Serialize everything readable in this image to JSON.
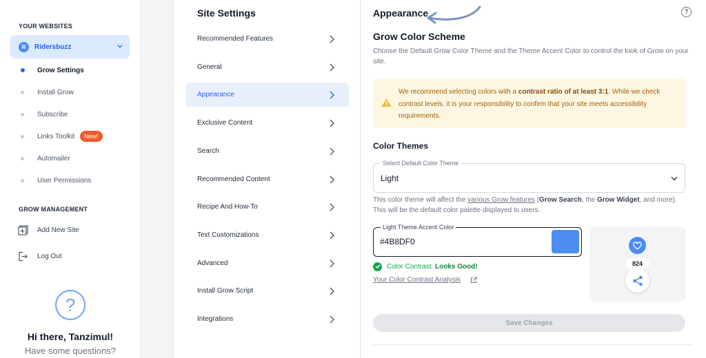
{
  "colors": {
    "accent": "#4B8DF0",
    "brand": "#2563eb",
    "badge": "#ef5a2a",
    "success": "#16a34a",
    "warning_bg": "#fdf6e3"
  },
  "sidebar": {
    "websites_title": "YOUR WEBSITES",
    "site": {
      "avatar_letter": "R",
      "name": "Ridersbuzz"
    },
    "nav": [
      {
        "label": "Grow Settings",
        "active": true
      },
      {
        "label": "Install Grow"
      },
      {
        "label": "Subscribe"
      },
      {
        "label": "Links Toolkit",
        "badge": "New!"
      },
      {
        "label": "Automailer"
      },
      {
        "label": "User Permissions"
      }
    ],
    "management_title": "GROW MANAGEMENT",
    "management": [
      {
        "label": "Add New Site",
        "icon": "add-site-icon"
      },
      {
        "label": "Log Out",
        "icon": "logout-icon"
      }
    ],
    "help": {
      "icon": "question-icon",
      "greeting": "Hi there, Tanzimul!",
      "question": "Have some questions?"
    }
  },
  "settings_menu": {
    "title": "Site Settings",
    "items": [
      "Recommended Features",
      "General",
      "Appearance",
      "Exclusive Content",
      "Search",
      "Recommended Content",
      "Recipe And How-To",
      "Text Customizations",
      "Advanced",
      "Install Grow Script",
      "Integrations"
    ],
    "active_item": "Appearance"
  },
  "content": {
    "title": "Appearance",
    "scheme_title": "Grow Color Scheme",
    "scheme_desc": "Choose the Default Grow Color Theme and the Theme Accent Color to control the look of Grow on your site.",
    "warning": {
      "pre": "We recommend selecting colors with a ",
      "bold": "contrast ratio of at least 3:1",
      "post": ". While we check contrast levels, it is your responsibility to confirm that your site meets accessibility requirements."
    },
    "themes_title": "Color Themes",
    "theme_select": {
      "legend": "Select Default Color Theme",
      "value": "Light"
    },
    "theme_desc": {
      "p1": "This color theme will affect the ",
      "link": "various Grow features",
      "p2": " (",
      "b1": "Grow Search",
      "p3": ", the ",
      "b2": "Grow Widget",
      "p4": ", and more). This will be the default color palette displayed to users."
    },
    "accent_field": {
      "legend": "Light Theme Accent Color",
      "value": "#4B8DF0"
    },
    "contrast": {
      "label": "Color Contrast: ",
      "result": "Looks Good!"
    },
    "analysis_link": "Your Color Contrast Analysis",
    "preview": {
      "count": "824",
      "heart_icon": "heart-icon",
      "share_icon": "share-icon"
    },
    "save_label": "Save Changes"
  }
}
